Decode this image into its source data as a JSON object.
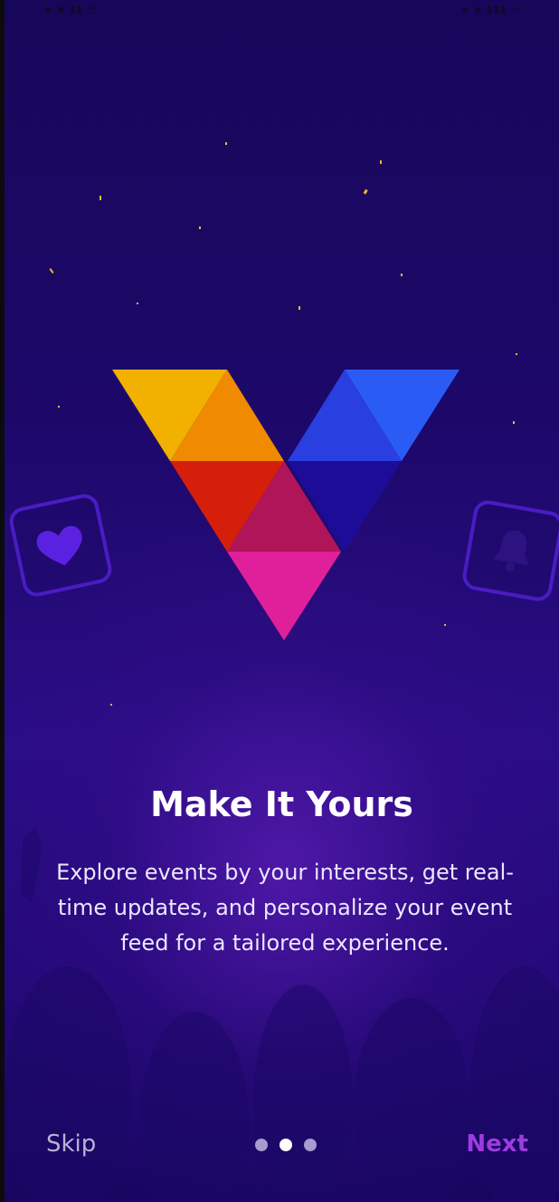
{
  "onboarding": {
    "title": "Make It Yours",
    "description": "Explore events by your interests, get real-time updates, and personalize your event feed for a tailored experience.",
    "skip_label": "Skip",
    "next_label": "Next",
    "pagination": {
      "total": 3,
      "active_index": 1
    }
  },
  "icons": {
    "left_tile": "heart-icon",
    "right_tile": "bell-icon"
  },
  "colors": {
    "accent": "#9d3be0",
    "background": "#1d086a",
    "logo_yellow": "#f2b000",
    "logo_orange": "#f08a00",
    "logo_red": "#d51f0a",
    "logo_magenta": "#b0155a",
    "logo_pink": "#e0209a",
    "logo_blue": "#2a5cf5",
    "logo_navy": "#1c0c98"
  }
}
